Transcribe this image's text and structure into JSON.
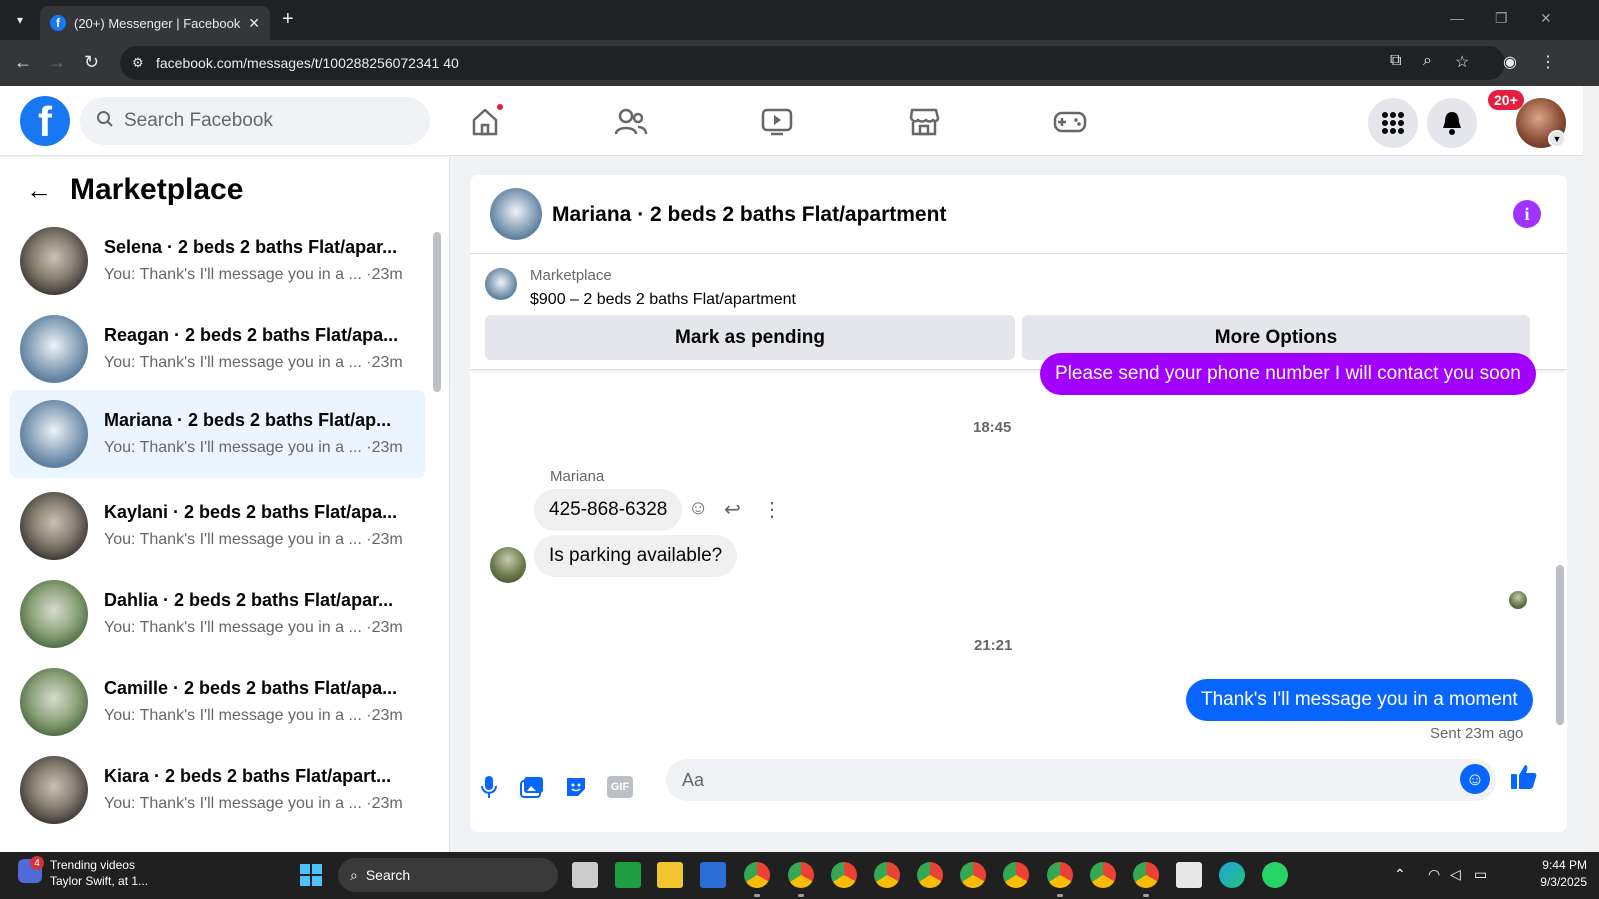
{
  "browser": {
    "tab_title": "(20+) Messenger | Facebook",
    "tab_close": "✕",
    "new_tab": "+",
    "url": "facebook.com/messages/t/100288256072341 40"
  },
  "fb_header": {
    "logo": "f",
    "search_placeholder": "Search Facebook",
    "notifications_badge": "20+"
  },
  "sidebar": {
    "title": "Marketplace",
    "conversations": [
      {
        "name": "Selena · 2 beds 2 baths Flat/apar...",
        "snippet": "You: Thank's I'll message you in a ... ·23m",
        "thumb": "interior",
        "active": false
      },
      {
        "name": "Reagan · 2 beds 2 baths Flat/apa...",
        "snippet": "You: Thank's I'll message you in a ... ·23m",
        "thumb": "building",
        "active": false
      },
      {
        "name": "Mariana · 2 beds 2 baths Flat/ap...",
        "snippet": "You: Thank's I'll message you in a ... ·23m",
        "thumb": "building",
        "active": true
      },
      {
        "name": "Kaylani · 2 beds 2 baths Flat/apa...",
        "snippet": "You: Thank's I'll message you in a ... ·23m",
        "thumb": "interior",
        "active": false
      },
      {
        "name": "Dahlia · 2 beds 2 baths Flat/apar...",
        "snippet": "You: Thank's I'll message you in a ... ·23m",
        "thumb": "aerial",
        "active": false
      },
      {
        "name": "Camille · 2 beds 2 baths Flat/apa...",
        "snippet": "You: Thank's I'll message you in a ... ·23m",
        "thumb": "aerial",
        "active": false
      },
      {
        "name": "Kiara · 2 beds 2 baths Flat/apart...",
        "snippet": "You: Thank's I'll message you in a ... ·23m",
        "thumb": "interior",
        "active": false
      }
    ]
  },
  "chat": {
    "title": "Mariana · 2 beds 2 baths Flat/apartment",
    "info_icon": "i",
    "listing": {
      "source": "Marketplace",
      "price_title": "$900 – 2 beds 2 baths Flat/apartment",
      "mark_pending": "Mark as pending",
      "more_options": "More Options"
    },
    "messages": {
      "prev_outgoing": "Please send your phone number I will contact you soon",
      "time1": "18:45",
      "sender": "Mariana",
      "phone": "425-868-6328",
      "question": "Is parking available?",
      "time2": "21:21",
      "reply": "Thank's I'll message you in a moment",
      "sent_status": "Sent 23m ago"
    },
    "composer_placeholder": "Aa"
  },
  "taskbar": {
    "weather_badge": "4",
    "weather_title": "Trending videos",
    "weather_sub": "Taylor Swift, at 1...",
    "search": "Search",
    "time": "9:44 PM",
    "date": "9/3/2025"
  }
}
